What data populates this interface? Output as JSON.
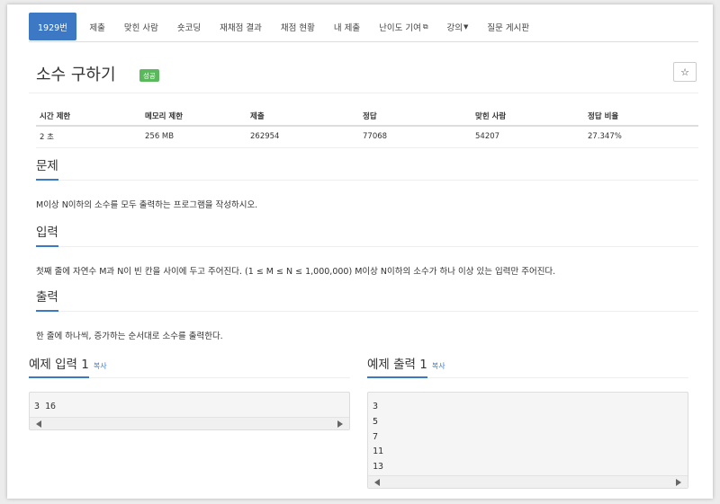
{
  "nav": {
    "tabs": [
      {
        "label": "1929번",
        "active": true
      },
      {
        "label": "제출"
      },
      {
        "label": "맞힌 사람"
      },
      {
        "label": "숏코딩"
      },
      {
        "label": "재채점 결과"
      },
      {
        "label": "채점 현황"
      },
      {
        "label": "내 제출"
      },
      {
        "label": "난이도 기여"
      },
      {
        "label": "강의"
      },
      {
        "label": "질문 게시판"
      }
    ]
  },
  "problem": {
    "title": "소수 구하기",
    "badge": "성공",
    "star": "☆"
  },
  "info_table": {
    "headers": [
      "시간 제한",
      "메모리 제한",
      "제출",
      "정답",
      "맞힌 사람",
      "정답 비율"
    ],
    "row": [
      "2 초",
      "256 MB",
      "262954",
      "77068",
      "54207",
      "27.347%"
    ]
  },
  "sections": {
    "description": {
      "heading": "문제",
      "text": "M이상 N이하의 소수를 모두 출력하는 프로그램을 작성하시오."
    },
    "input": {
      "heading": "입력",
      "text": "첫째 줄에 자연수 M과 N이 빈 칸을 사이에 두고 주어진다. (1 ≤ M ≤ N ≤ 1,000,000) M이상 N이하의 소수가 하나 이상 있는 입력만 주어진다."
    },
    "output": {
      "heading": "출력",
      "text": "한 줄에 하나씩, 증가하는 순서대로 소수를 출력한다."
    }
  },
  "samples": {
    "input": {
      "heading": "예제 입력 1",
      "copy": "복사",
      "content": "3 16"
    },
    "output": {
      "heading": "예제 출력 1",
      "copy": "복사",
      "content": "3\n5\n7\n11\n13"
    }
  },
  "colors": {
    "accent": "#3c78c3",
    "success": "#5cb85c"
  }
}
